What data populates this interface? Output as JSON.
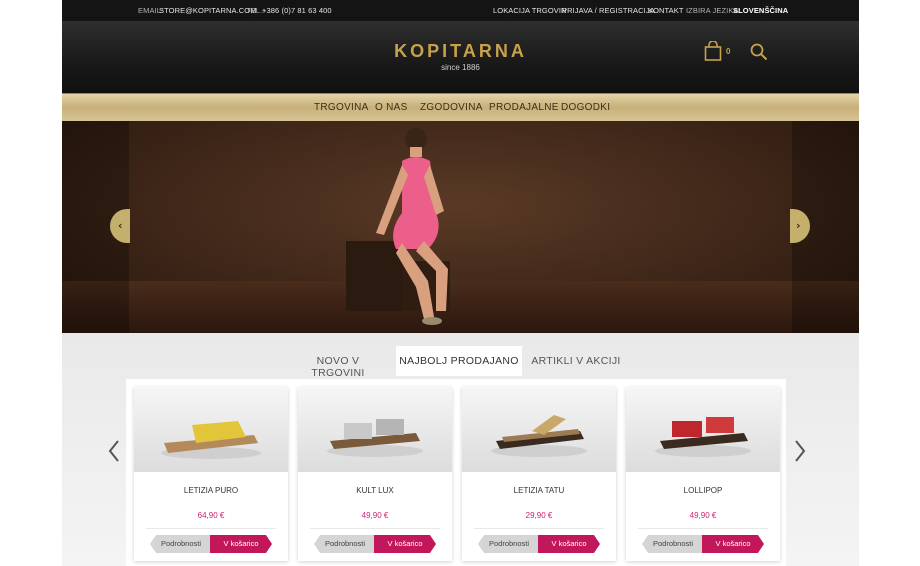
{
  "topbar": {
    "email_label": "EMAIL:",
    "email_value": "STORE@KOPITARNA.COM",
    "phone_label": "TEL.:",
    "phone_value": "+386 (0)7 81 63 400",
    "store_locations": "LOKACIJA TRGOVIN",
    "login": "PRIJAVA / REGISTRACIJA",
    "contact": "KONTAKT",
    "language_label": "IZBIRA JEZIKA:",
    "language_value": "SLOVENŠČINA"
  },
  "header": {
    "logo": "KOPITARNA",
    "logo_sub": "since 1886",
    "cart_count": "0",
    "icons": [
      "shopping-bag-icon",
      "search-icon"
    ],
    "accent_color": "#c8a24a"
  },
  "nav": {
    "items": [
      "TRGOVINA",
      "O NAS",
      "ZGODOVINA",
      "PRODAJALNE",
      "DOGODKI"
    ]
  },
  "hero": {
    "prev_icon": "chevron-left-icon",
    "next_icon": "chevron-right-icon"
  },
  "tabs": {
    "items": [
      "NOVO V TRGOVINI",
      "NAJBOLJ PRODAJANO",
      "ARTIKLI V AKCIJI"
    ],
    "active_index": 1
  },
  "products": [
    {
      "name": "LETIZIA PURO",
      "price": "64,90 €",
      "details_label": "Podrobnosti",
      "cart_label": "V košarico",
      "color": "#e3c53a"
    },
    {
      "name": "KULT LUX",
      "price": "49,90 €",
      "details_label": "Podrobnosti",
      "cart_label": "V košarico",
      "color": "#c9c9c9"
    },
    {
      "name": "LETIZIA TATU",
      "price": "29,90 €",
      "details_label": "Podrobnosti",
      "cart_label": "V košarico",
      "color": "#c9a86a"
    },
    {
      "name": "LOLLIPOP",
      "price": "49,90 €",
      "details_label": "Podrobnosti",
      "cart_label": "V košarico",
      "color": "#c0262e"
    }
  ],
  "colors": {
    "price": "#d01f73",
    "cart_button": "#c2185b",
    "details_button": "#d5d5d5",
    "nav_gold": "#c7b07a"
  }
}
